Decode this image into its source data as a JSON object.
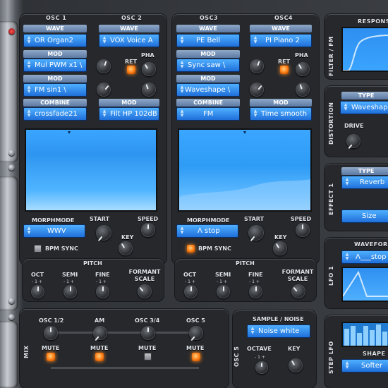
{
  "osc12": {
    "col1_title": "OSC 1",
    "col2_title": "OSC 2",
    "wave_label_1": "WAVE",
    "wave_label_2": "WAVE",
    "wave_1": "OR Organ2",
    "wave_2": "VOX Voice A",
    "mod_label_1": "MOD",
    "mod_1": "Mul PWM x1 \\",
    "pha_label": "PHA",
    "ret_label": "RET",
    "mod_label_2": "MOD",
    "mod_2": "FM sin1 \\",
    "combine_label": "COMBINE",
    "mod_label_3": "MOD",
    "combine": "crossfade21",
    "mod_3": "Filt HP 102dB",
    "morphmode_label": "MORPHMODE",
    "start_label": "START",
    "speed_label": "SPEED",
    "key_label": "KEY",
    "morphmode": "WWV",
    "bpm_label": "BPM SYNC",
    "pitch_label": "PITCH",
    "oct_label": "OCT",
    "semi_label": "SEMI",
    "fine_label": "FINE",
    "formant_label": "FORMANT SCALE",
    "scale_marks": "- 1 +"
  },
  "osc34": {
    "col1_title": "OSC3",
    "col2_title": "OSC4",
    "wave_label_1": "WAVE",
    "wave_label_2": "WAVE",
    "wave_1": "PE Bell",
    "wave_2": "PI Piano 2",
    "mod_label_1": "MOD",
    "mod_1": "Sync saw \\",
    "pha_label": "PHA",
    "ret_label": "RET",
    "mod_label_2": "MOD",
    "mod_2": "Waveshape \\",
    "combine_label": "COMBINE",
    "mod_label_3": "MOD",
    "combine": "FM",
    "mod_3": "Time smooth",
    "morphmode_label": "MORPHMODE",
    "start_label": "START",
    "speed_label": "SPEED",
    "key_label": "KEY",
    "morphmode": "Λ stop",
    "bpm_label": "BPM SYNC",
    "pitch_label": "PITCH",
    "oct_label": "OCT",
    "semi_label": "SEMI",
    "fine_label": "FINE",
    "formant_label": "FORMANT SCALE",
    "scale_marks": "- 1 +"
  },
  "mix": {
    "section_label": "MIX",
    "osc12": "OSC 1/2",
    "am": "AM",
    "osc34": "OSC 3/4",
    "osc5": "OSC 5",
    "mute": "MUTE"
  },
  "osc5": {
    "section_label": "OSC 5",
    "title": "SAMPLE / NOISE",
    "value": "Noise white",
    "octave_label": "OCTAVE",
    "key_label": "KEY",
    "scale_marks": "- 1 +"
  },
  "filter": {
    "section_label": "FILTER / FM",
    "title": "RESPONSE"
  },
  "distortion": {
    "section_label": "DISTORTION",
    "type_label": "TYPE",
    "type": "Waveshape",
    "drive_label": "DRIVE"
  },
  "effect": {
    "section_label": "EFFECT 1",
    "type_label": "TYPE",
    "type": "Reverb",
    "size": "Size"
  },
  "lfo": {
    "section_label": "LFO 1",
    "waveform_label": "WAVEFORM",
    "waveform": "Λ___stop"
  },
  "steplfo": {
    "section_label": "STEP LFO",
    "shape_label": "SHAPE",
    "shape": "Softer"
  },
  "colors": {
    "accent_blue": "#2e9bff",
    "led_orange": "#ff7a10",
    "panel": "#26282c"
  }
}
